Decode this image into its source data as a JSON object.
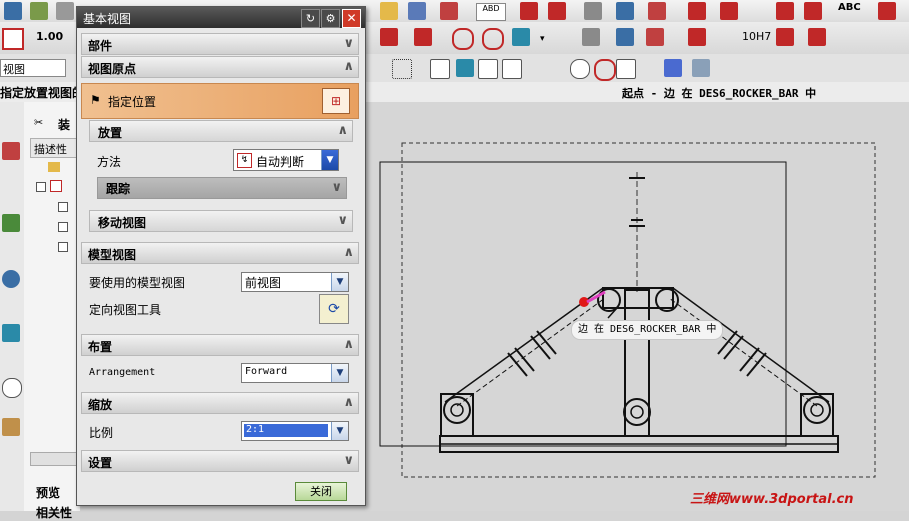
{
  "toolbar": {
    "zoom_value": "1.00",
    "view_combo": "视图",
    "grid_label": "10H7",
    "abc_label": "ABC",
    "abd_label": "ABD"
  },
  "cue_line": {
    "left_text": "指定放置视图的",
    "right_text": "起点 - 边 在 DES6_ROCKER_BAR 中"
  },
  "navigator": {
    "assembly_label": "装",
    "column_header": "描述性",
    "preview_label": "预览",
    "bottom_label": "相关性"
  },
  "dialog": {
    "title": "基本视图",
    "section_part": "部件",
    "section_view_origin": "视图原点",
    "specify_location": "指定位置",
    "placement": "放置",
    "method_label": "方法",
    "method_value": "自动判断",
    "tracking": "跟踪",
    "move_view": "移动视图",
    "model_view": "模型视图",
    "model_view_to_use_label": "要使用的模型视图",
    "model_view_to_use_value": "前视图",
    "orient_view_tool": "定向视图工具",
    "layout": "布置",
    "arrangement_label": "Arrangement",
    "arrangement_value": "Forward",
    "scale": "缩放",
    "scale_label": "比例",
    "scale_value": "2:1",
    "settings": "设置",
    "close_button": "关闭"
  },
  "graphics": {
    "tooltip": "边 在 DES6_ROCKER_BAR 中"
  },
  "watermark": "三维网www.3dportal.cn"
}
